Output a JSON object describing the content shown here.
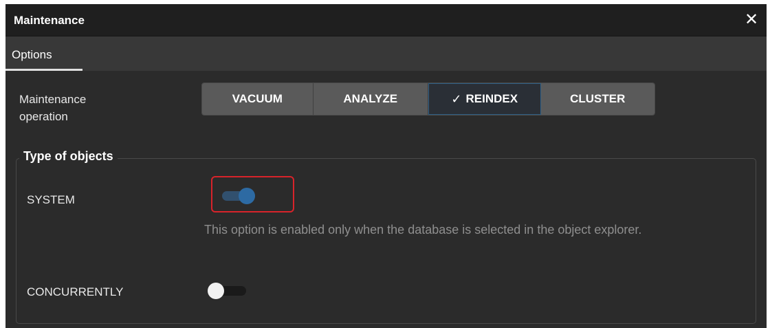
{
  "dialog": {
    "title": "Maintenance",
    "close_icon": "close-icon",
    "close_glyph": "✕"
  },
  "tabs": [
    {
      "label": "Options",
      "active": true
    }
  ],
  "maintenance_operation": {
    "label_line1": "Maintenance",
    "label_line2": "operation",
    "options": [
      "VACUUM",
      "ANALYZE",
      "REINDEX",
      "CLUSTER"
    ],
    "selected": "REINDEX",
    "check_glyph": "✓"
  },
  "type_of_objects": {
    "legend": "Type of objects",
    "system": {
      "label": "SYSTEM",
      "enabled": true,
      "help_text": "This option is enabled only when the database is selected in the object explorer."
    },
    "concurrently": {
      "label": "CONCURRENTLY",
      "enabled": false
    }
  },
  "colors": {
    "accent": "#2d6aa3",
    "highlight": "#d9232a",
    "background": "#2b2b2b",
    "titlebar": "#1f1f1f"
  }
}
